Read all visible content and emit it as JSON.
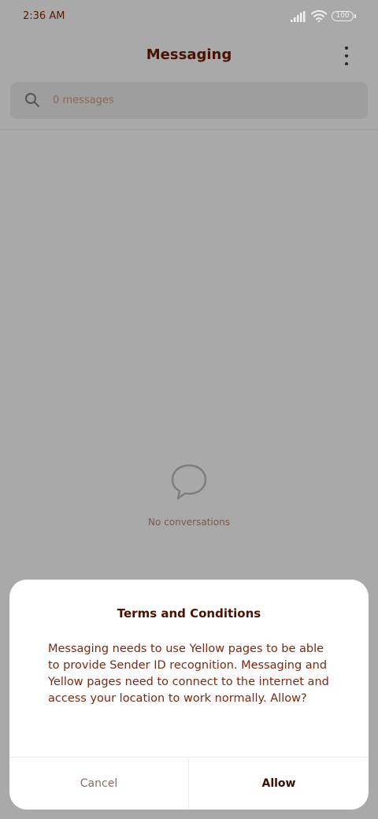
{
  "status_bar": {
    "time": "2:36 AM",
    "battery": "100",
    "icons": [
      "signal-icon",
      "wifi-icon",
      "battery-icon"
    ]
  },
  "header": {
    "title": "Messaging",
    "more_icon": "more-vert-icon"
  },
  "search": {
    "placeholder": "0 messages",
    "icon": "search-icon"
  },
  "empty_state": {
    "icon": "chat-bubble-icon",
    "text": "No conversations"
  },
  "dialog": {
    "title": "Terms and Conditions",
    "body": "Messaging needs to use Yellow pages to be able to provide Sender ID recognition. Messaging and Yellow pages need to connect to the internet and access your location to work normally. Allow?",
    "cancel_label": "Cancel",
    "allow_label": "Allow"
  },
  "colors": {
    "text_accent": "#5a1a00",
    "background_dim": "#a9a9a9",
    "dialog_background": "#ffffff"
  }
}
